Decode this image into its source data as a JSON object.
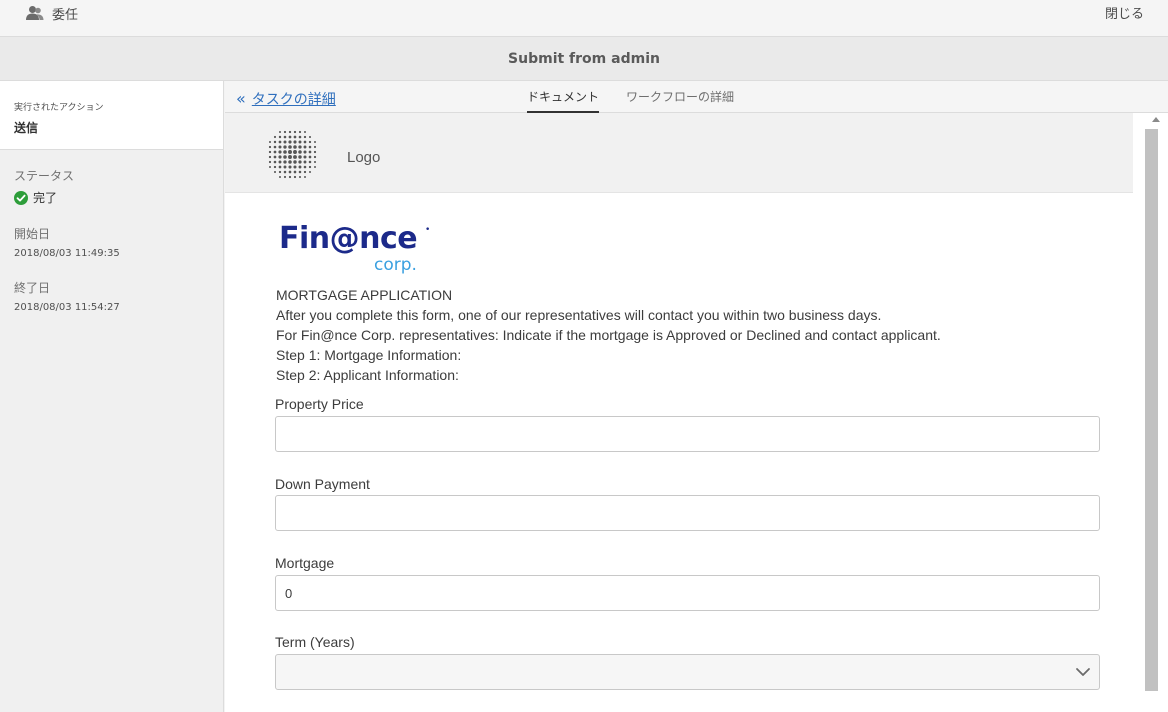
{
  "topbar": {
    "delegate_label": "委任",
    "close_label": "閉じる"
  },
  "titlebar": {
    "title": "Submit from admin"
  },
  "sidebar": {
    "action_label": "実行されたアクション",
    "action_value": "送信",
    "status_label": "ステータス",
    "status_value": "完了",
    "start_label": "開始日",
    "start_value": "2018/08/03 11:49:35",
    "end_label": "終了日",
    "end_value": "2018/08/03 11:54:27"
  },
  "tabs": {
    "back_chevron": "«",
    "back_label": "タスクの詳細",
    "document_label": "ドキュメント",
    "workflow_label": "ワークフローの詳細"
  },
  "form": {
    "logo_label": "Logo",
    "brand_main": "Fin@nce",
    "brand_sub": "corp.",
    "brand_mark": "•",
    "intro": [
      "MORTGAGE APPLICATION",
      "After you complete this form, one of our representatives will contact you within two business days.",
      "For Fin@nce Corp. representatives: Indicate if the mortgage is Approved or Declined and contact applicant.",
      "Step 1: Mortgage Information:",
      "Step 2: Applicant Information:"
    ],
    "fields": {
      "property_price_label": "Property Price",
      "property_price_value": "",
      "down_payment_label": "Down Payment",
      "down_payment_value": "",
      "mortgage_label": "Mortgage",
      "mortgage_value": "0",
      "term_label": "Term (Years)",
      "term_value": ""
    }
  },
  "colors": {
    "link": "#2f6fbd",
    "success": "#2d9d3a",
    "brand_navy": "#1c2a8a",
    "brand_light": "#3aa0e0"
  },
  "icons": {
    "delegate": "users-icon",
    "status": "check-circle-icon",
    "select": "chevron-down-icon",
    "logo": "dotted-sphere-icon"
  }
}
